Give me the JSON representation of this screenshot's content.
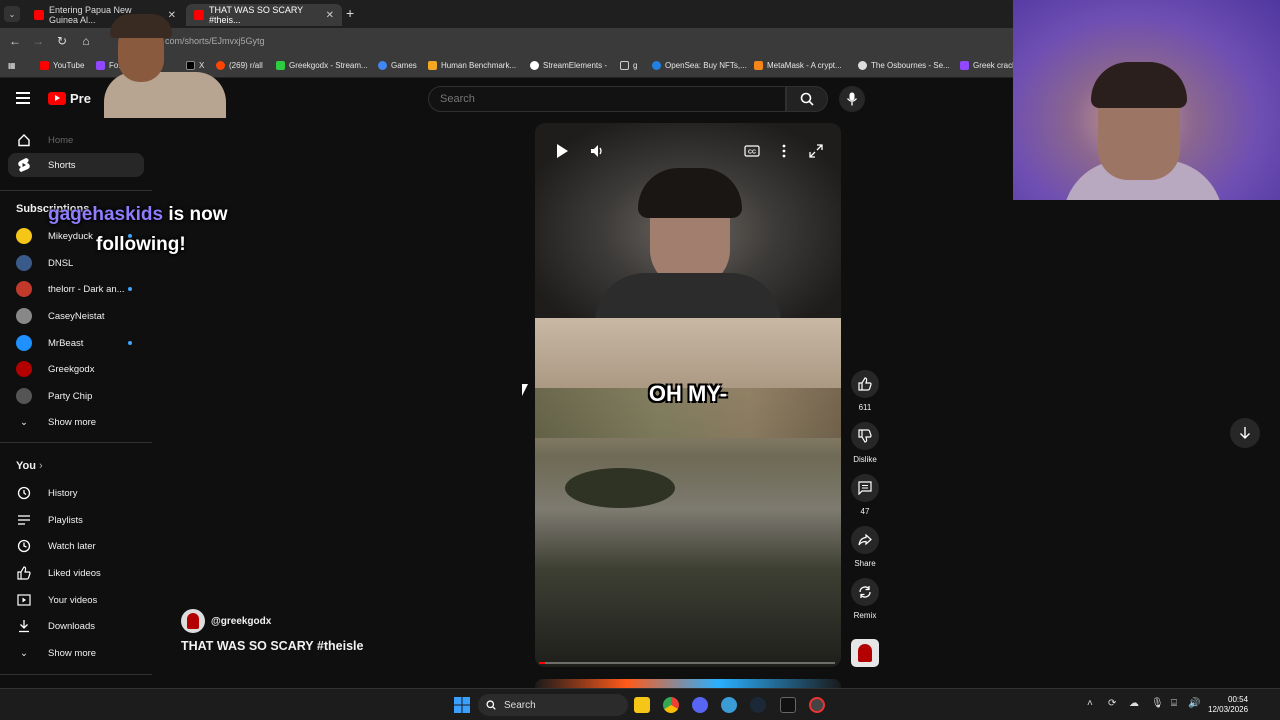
{
  "browser": {
    "tabs": [
      {
        "label": "Entering Papua New Guinea Al...",
        "active": false
      },
      {
        "label": "THAT WAS SO SCARY #theis...",
        "active": true
      }
    ],
    "url": "com/shorts/EJmvxj5Gytg",
    "bookmarks": [
      {
        "label": "YouTube",
        "color": "#ff0000"
      },
      {
        "label": "Fo...tch",
        "color": "#9146ff"
      },
      {
        "label": "X",
        "color": "#000000"
      },
      {
        "label": "(269) r/all",
        "color": "#ff4500"
      },
      {
        "label": "Greekgodx - Stream...",
        "color": "#2ecc40"
      },
      {
        "label": "Games",
        "color": "#4285f4"
      },
      {
        "label": "Human Benchmark...",
        "color": "#f5a623"
      },
      {
        "label": "StreamElements -",
        "color": "#ffffff"
      },
      {
        "label": "g",
        "color": "#cccccc"
      },
      {
        "label": "OpenSea: Buy NFTs,...",
        "color": "#2081e2"
      },
      {
        "label": "MetaMask - A crypt...",
        "color": "#f6851b"
      },
      {
        "label": "The Osbournes - Se...",
        "color": "#dddddd"
      },
      {
        "label": "Greek crack",
        "color": "#9146ff"
      }
    ]
  },
  "youtube": {
    "logo_text": "Pre",
    "search_placeholder": "Search",
    "sidebar": {
      "home": "Home",
      "shorts": "Shorts",
      "subscriptions_heading": "Subscriptions",
      "subscriptions": [
        {
          "label": "Mikeyduck",
          "live": true,
          "color": "#f5c518"
        },
        {
          "label": "DNSL",
          "live": false,
          "color": "#3a5a8a"
        },
        {
          "label": "thelorr - Dark an...",
          "live": true,
          "color": "#c0392b"
        },
        {
          "label": "CaseyNeistat",
          "live": false,
          "color": "#888888"
        },
        {
          "label": "MrBeast",
          "live": true,
          "color": "#1e90ff"
        },
        {
          "label": "Greekgodx",
          "live": false,
          "color": "#b30000"
        },
        {
          "label": "Party Chip",
          "live": false,
          "color": "#555555"
        }
      ],
      "show_more": "Show more",
      "you_heading": "You",
      "you_items": [
        "History",
        "Playlists",
        "Watch later",
        "Liked videos",
        "Your videos",
        "Downloads"
      ],
      "show_more_2": "Show more"
    },
    "short": {
      "caption": "OH MY-",
      "channel": "@greekgodx",
      "title": "THAT WAS SO SCARY #theisle",
      "progress": 0.02,
      "likes": "611",
      "dislike_label": "Dislike",
      "comments": "47",
      "share_label": "Share",
      "remix_label": "Remix"
    }
  },
  "stream_overlay": {
    "follower": "gagehaskids",
    "line1_rest": " is now",
    "line2": "following!"
  },
  "taskbar": {
    "search_label": "Search",
    "time": "00:54",
    "date": "12/03/2026"
  }
}
